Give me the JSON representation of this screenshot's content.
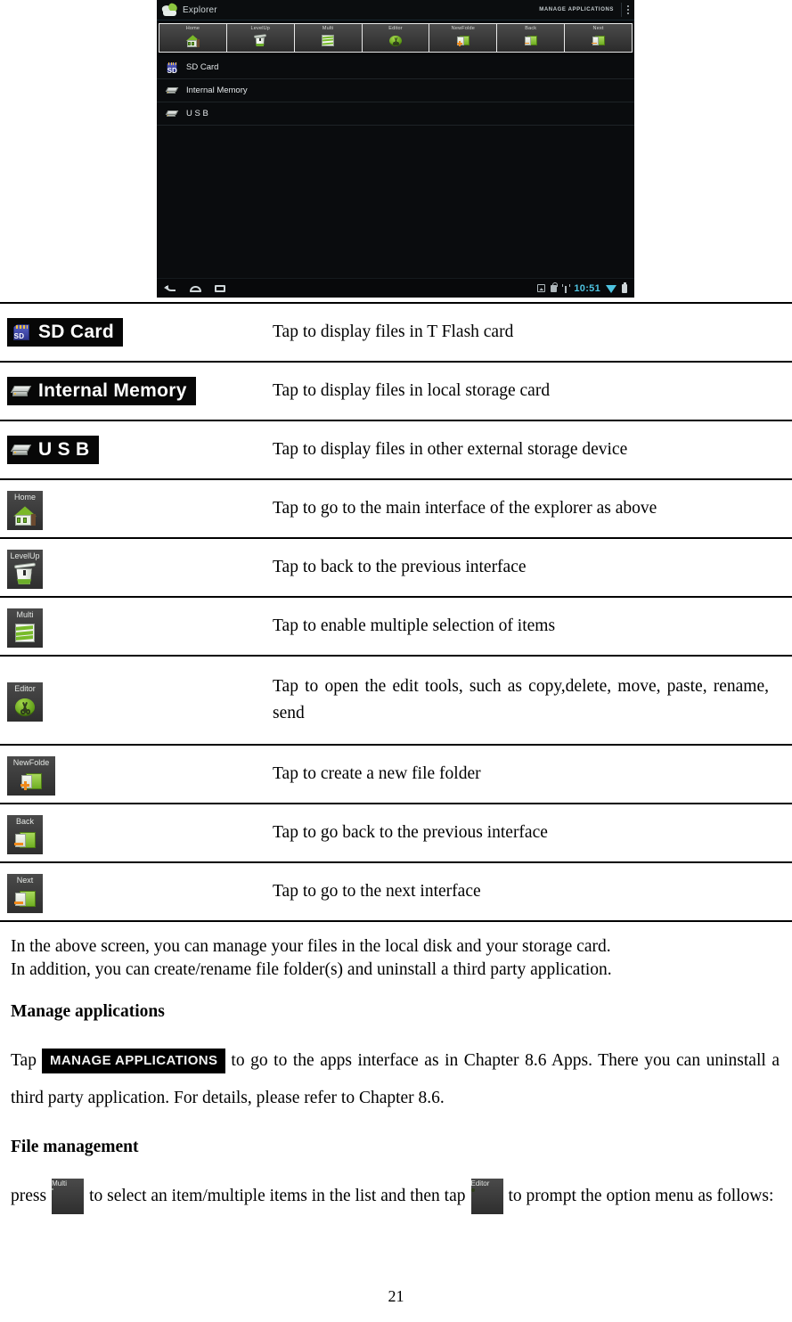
{
  "screenshot": {
    "app_title": "Explorer",
    "manage_apps_label": "MANAGE APPLICATIONS",
    "toolbar": [
      {
        "label": "Home",
        "icon": "home-icon"
      },
      {
        "label": "LevelUp",
        "icon": "levelup-trash-icon"
      },
      {
        "label": "Multi",
        "icon": "multi-select-icon"
      },
      {
        "label": "Editor",
        "icon": "editor-scissors-icon"
      },
      {
        "label": "NewFolde",
        "icon": "new-folder-icon"
      },
      {
        "label": "Back",
        "icon": "back-folder-icon"
      },
      {
        "label": "Next",
        "icon": "next-folder-icon"
      }
    ],
    "storage_list": [
      {
        "label": "SD Card",
        "icon": "sd-card-icon"
      },
      {
        "label": "Internal Memory",
        "icon": "hdd-icon"
      },
      {
        "label": "U S B",
        "icon": "hdd-icon"
      }
    ],
    "navbar": {
      "time": "10:51",
      "icons": [
        "back-icon",
        "home-icon",
        "recents-icon",
        "screenshot-icon",
        "lock-icon",
        "usb-icon",
        "wifi-icon",
        "battery-icon"
      ]
    }
  },
  "table": {
    "rows": [
      {
        "kind": "chip",
        "label": "SD Card",
        "icon": "sd-card-icon",
        "desc": "Tap to display files in T Flash card"
      },
      {
        "kind": "chip",
        "label": "Internal Memory",
        "icon": "hdd-icon",
        "desc": "Tap to display files in local storage card"
      },
      {
        "kind": "chip",
        "label": "U S B",
        "icon": "hdd-icon",
        "desc": "Tap to display files in other external storage device"
      },
      {
        "kind": "tile",
        "label": "Home",
        "icon": "home-icon",
        "desc": "Tap to go to the main interface of the explorer as above"
      },
      {
        "kind": "tile",
        "label": "LevelUp",
        "icon": "levelup-trash-icon",
        "desc": "Tap to back to the previous interface"
      },
      {
        "kind": "tile",
        "label": "Multi",
        "icon": "multi-select-icon",
        "desc": "Tap to enable multiple selection of items"
      },
      {
        "kind": "tile",
        "label": "Editor",
        "icon": "editor-scissors-icon",
        "desc": "Tap to open the edit tools, such as copy,delete, move, paste, rename, send"
      },
      {
        "kind": "tile",
        "label": "NewFolde",
        "icon": "new-folder-icon",
        "desc": "Tap to create a new file folder"
      },
      {
        "kind": "tile",
        "label": "Back",
        "icon": "back-folder-icon",
        "desc": "Tap to go back to the previous interface"
      },
      {
        "kind": "tile",
        "label": "Next",
        "icon": "next-folder-icon",
        "desc": "Tap to go to the next interface"
      }
    ]
  },
  "body": {
    "intro_line1": "In the above screen, you can manage your files in the local disk and your storage card.",
    "intro_line2": "In addition, you can create/rename file folder(s) and uninstall a third party application.",
    "heading_manage": "Manage applications",
    "manage_pre": "Tap",
    "manage_chip": "MANAGE APPLICATIONS",
    "manage_mid": "to go to the apps interface as in Chapter 8.6 Apps. There",
    "manage_line2": "you can uninstall a third party application. For details, please refer to Chapter 8.6.",
    "heading_file": "File management",
    "file_pre": "press",
    "file_tile1_label": "Multi",
    "file_mid": "to select an item/multiple items in the list and then tap",
    "file_tile2_label": "Editor",
    "file_post": "to prompt the",
    "file_line2": "option menu as follows:"
  },
  "page_number": "21"
}
